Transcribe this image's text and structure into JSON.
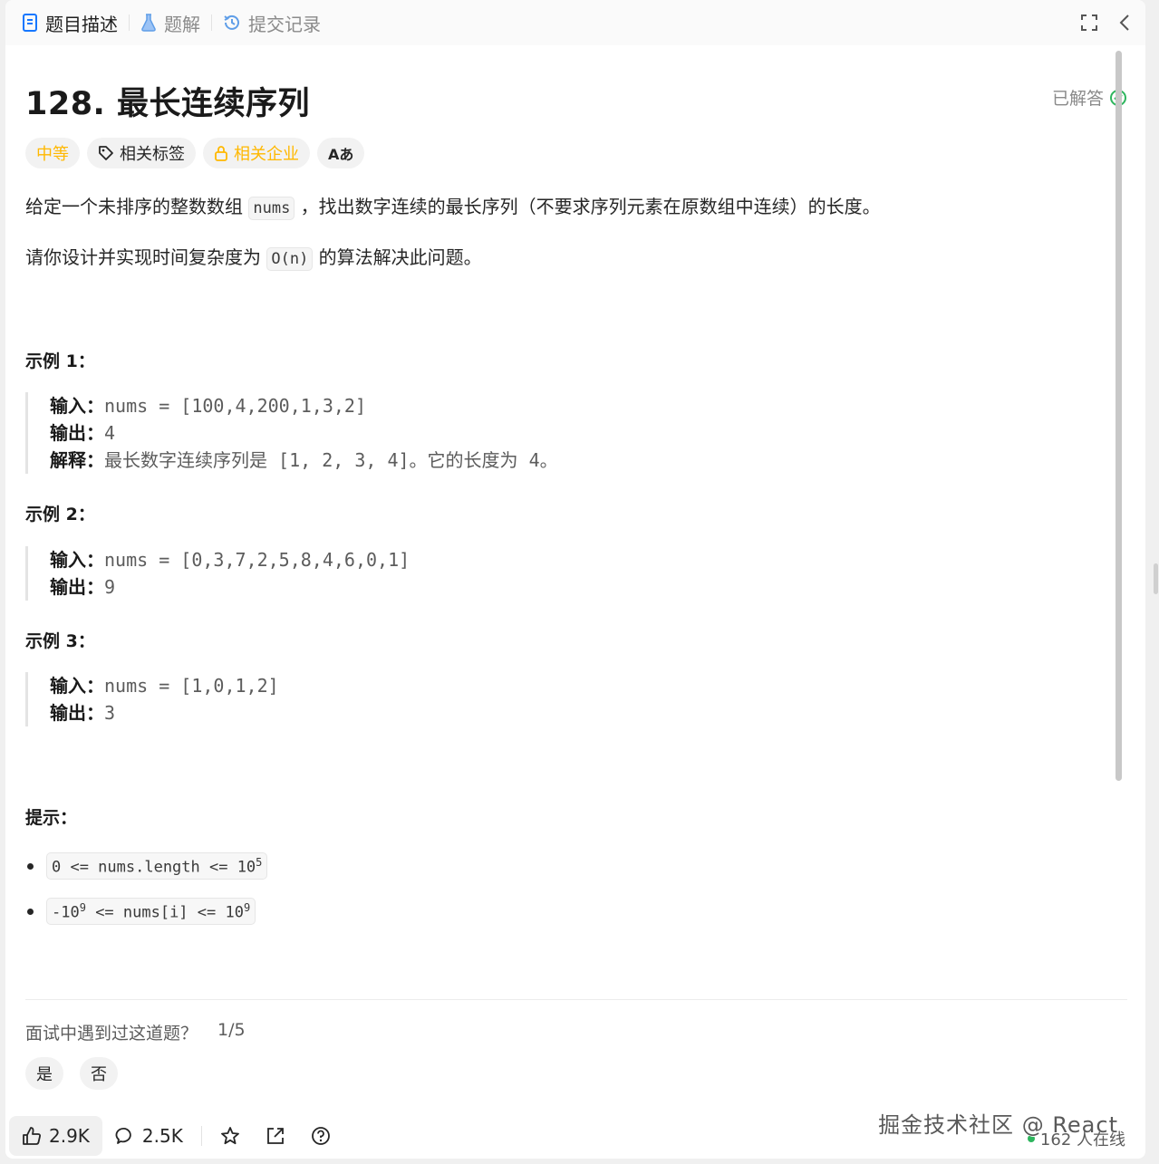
{
  "tabs": [
    {
      "label": "题目描述",
      "icon": "document-icon",
      "active": true
    },
    {
      "label": "题解",
      "icon": "flask-icon",
      "active": false
    },
    {
      "label": "提交记录",
      "icon": "history-icon",
      "active": false
    }
  ],
  "problem": {
    "title": "128. 最长连续序列",
    "status": "已解答",
    "tags": {
      "difficulty": "中等",
      "topics": "相关标签",
      "companies": "相关企业",
      "translate": "Aあ"
    },
    "desc1_a": "给定一个未排序的整数数组",
    "desc1_code": "nums",
    "desc1_b": "，找出数字连续的最长序列（不要求序列元素在原数组中连续）的长度。",
    "desc2_a": "请你设计并实现时间复杂度为",
    "desc2_code": "O(n)",
    "desc2_b": "的算法解决此问题。"
  },
  "examples": [
    {
      "heading": "示例 1：",
      "input_label": "输入：",
      "input": "nums = [100,4,200,1,3,2]",
      "output_label": "输出：",
      "output": "4",
      "explain_label": "解释：",
      "explain": "最长数字连续序列是 [1, 2, 3, 4]。它的长度为 4。"
    },
    {
      "heading": "示例 2：",
      "input_label": "输入：",
      "input": "nums = [0,3,7,2,5,8,4,6,0,1]",
      "output_label": "输出：",
      "output": "9"
    },
    {
      "heading": "示例 3：",
      "input_label": "输入：",
      "input": "nums = [1,0,1,2]",
      "output_label": "输出：",
      "output": "3"
    }
  ],
  "hints": {
    "heading": "提示：",
    "items": [
      {
        "a": "0 <= nums.length <= 10",
        "sup": "5"
      },
      {
        "a": "-10",
        "sup1": "9",
        "b": " <= nums[i] <= 10",
        "sup2": "9"
      }
    ]
  },
  "interview": {
    "question": "面试中遇到过这道题？",
    "count": "1/5",
    "yes": "是",
    "no": "否"
  },
  "footer": {
    "likes": "2.9K",
    "comments": "2.5K",
    "online": "162 人在线",
    "watermark": "掘金技术社区 @ React"
  },
  "colors": {
    "difficulty_medium": "#ffb800",
    "solved_green": "#2db55d",
    "active_tab_icon": "#1677ff"
  }
}
